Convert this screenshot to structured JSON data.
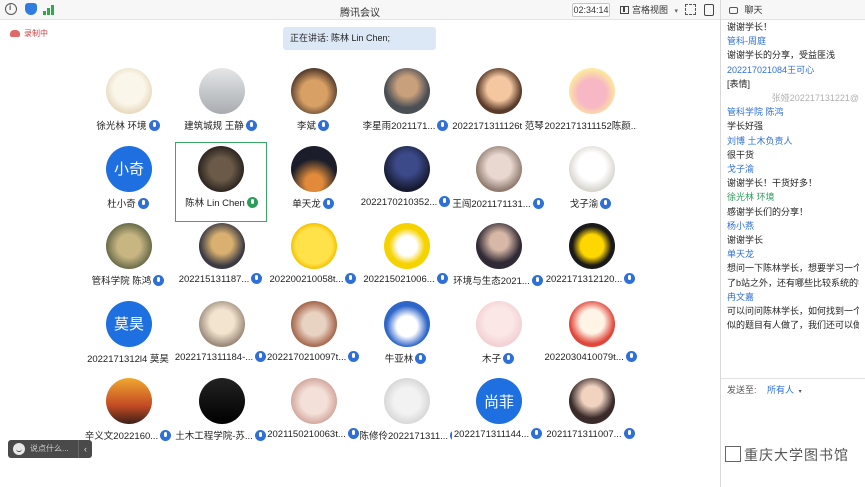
{
  "titlebar": {
    "title": "腾讯会议",
    "timer": "02:34:14",
    "view_label": "宫格视图",
    "caret": "▾"
  },
  "recording_label": "录制中",
  "speaking_banner": "正在讲话: 陈林 Lin Chen;",
  "participants": [
    {
      "name": "徐光林 环境",
      "avatar": "beige",
      "mic": "muted"
    },
    {
      "name": "建筑城规 王静",
      "avatar": "street",
      "mic": "muted"
    },
    {
      "name": "李斌",
      "avatar": "dog",
      "mic": "muted"
    },
    {
      "name": "李星雨2021171...",
      "avatar": "man",
      "mic": "muted"
    },
    {
      "name": "2022171311126t 范琴",
      "avatar": "cartoon",
      "mic": "none"
    },
    {
      "name": "2022171311152陈颜...",
      "avatar": "pig",
      "mic": "none"
    },
    {
      "name": "杜小奇",
      "avatar": "text",
      "avatar_text": "小奇",
      "mic": "muted"
    },
    {
      "name": "陈林 Lin Chen",
      "avatar": "dog2",
      "mic": "speaking",
      "active": true
    },
    {
      "name": "单天龙",
      "avatar": "night",
      "mic": "muted"
    },
    {
      "name": "2022170210352...",
      "avatar": "tower",
      "mic": "muted"
    },
    {
      "name": "王闯2021171131...",
      "avatar": "girl",
      "mic": "muted"
    },
    {
      "name": "戈子渝",
      "avatar": "bear",
      "mic": "muted"
    },
    {
      "name": "管科学院 陈鸿",
      "avatar": "plant",
      "mic": "muted"
    },
    {
      "name": "202215131187...",
      "avatar": "anime",
      "mic": "muted"
    },
    {
      "name": "202200210058t...",
      "avatar": "emoji",
      "mic": "muted"
    },
    {
      "name": "202215021006...",
      "avatar": "duck",
      "mic": "muted"
    },
    {
      "name": "环境与生态2021...",
      "avatar": "woman",
      "mic": "muted"
    },
    {
      "name": "2022171312120...",
      "avatar": "star",
      "mic": "muted"
    },
    {
      "name": "2022171312l4 莫昊",
      "avatar": "text",
      "avatar_text": "莫昊",
      "mic": "none"
    },
    {
      "name": "2022171311184-...",
      "avatar": "anime2",
      "mic": "muted"
    },
    {
      "name": "2022170210097t...",
      "avatar": "bear2",
      "mic": "muted"
    },
    {
      "name": "牛亚林",
      "avatar": "donald",
      "mic": "muted"
    },
    {
      "name": "木子",
      "avatar": "girl2",
      "mic": "muted"
    },
    {
      "name": "2022030410079t...",
      "avatar": "doll",
      "mic": "muted"
    },
    {
      "name": "辛义文2022160...",
      "avatar": "sunset",
      "mic": "muted"
    },
    {
      "name": "土木工程学院-苏...",
      "avatar": "night2",
      "mic": "muted"
    },
    {
      "name": "2021150210063t...",
      "avatar": "cats",
      "mic": "muted"
    },
    {
      "name": "陈修伶2022171311...",
      "avatar": "person",
      "mic": "muted"
    },
    {
      "name": "2022171311144...",
      "avatar": "text",
      "avatar_text": "尚菲",
      "mic": "muted"
    },
    {
      "name": "2021171311007...",
      "avatar": "woman2",
      "mic": "muted"
    }
  ],
  "chat_input_placeholder": "说点什么...",
  "chat_input_arrow": "‹",
  "chat": {
    "title": "聊天",
    "messages": [
      {
        "kind": "text",
        "text": "谢谢学长！"
      },
      {
        "kind": "sender",
        "text": "管科-周庭"
      },
      {
        "kind": "text",
        "text": "谢谢学长的分享，受益匪浅"
      },
      {
        "kind": "sender",
        "text": "202217021084王可心"
      },
      {
        "kind": "text",
        "text": "[表情]"
      },
      {
        "kind": "faded",
        "text": "张娅202217131221@"
      },
      {
        "kind": "sender",
        "text": "管科学院 陈鸿"
      },
      {
        "kind": "text",
        "text": "学长好强"
      },
      {
        "kind": "sender",
        "text": "刘博 土木负责人"
      },
      {
        "kind": "text",
        "text": "很干货"
      },
      {
        "kind": "sender",
        "text": "戈子渝"
      },
      {
        "kind": "text",
        "text": "谢谢学长！干货好多！"
      },
      {
        "kind": "sender-green",
        "text": "徐光林 环境"
      },
      {
        "kind": "text",
        "text": "感谢学长们的分享！"
      },
      {
        "kind": "sender",
        "text": "杨小燕"
      },
      {
        "kind": "text",
        "text": "谢谢学长"
      },
      {
        "kind": "sender",
        "text": "单天龙"
      },
      {
        "kind": "text",
        "text": "想问一下陈林学长，想要学习一个数"
      },
      {
        "kind": "text",
        "text": "了b站之外，还有哪些比较系统的学"
      },
      {
        "kind": "sender",
        "text": "冉文嘉"
      },
      {
        "kind": "text",
        "text": "可以问问陈林学长，如何找到一个好"
      },
      {
        "kind": "text",
        "text": "似的题目有人做了，我们还可以做吗"
      }
    ],
    "send_to_label": "发送至:",
    "send_to_value": "所有人",
    "send_to_caret": "▾",
    "watermark": "重庆大学图书馆"
  },
  "colors": {
    "accent_blue": "#2f6fd8",
    "speaking_green": "#39a864",
    "banner_bg": "#dde8f6"
  }
}
